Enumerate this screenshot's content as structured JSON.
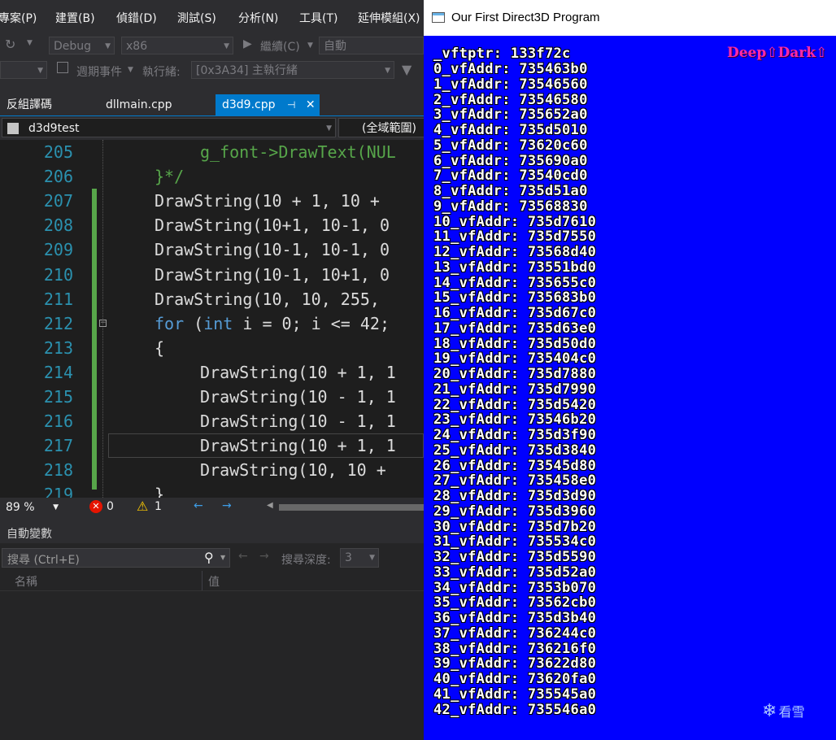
{
  "vs": {
    "menu": [
      "專案(P)",
      "建置(B)",
      "偵錯(D)",
      "測試(S)",
      "分析(N)",
      "工具(T)",
      "延伸模組(X)"
    ],
    "toolbar": {
      "config": "Debug",
      "platform": "x86",
      "continue": "繼續(C)",
      "auto": "自動"
    },
    "toolbar2": {
      "events": "週期事件",
      "thread_label": "執行緒:",
      "thread_value": "[0x3A34] 主執行緒"
    },
    "tabs": [
      {
        "label": "反組譯碼"
      },
      {
        "label": "dllmain.cpp"
      },
      {
        "label": "d3d9.cpp",
        "pin": "⊣",
        "close": "✕"
      }
    ],
    "nav": {
      "project": "d3d9test",
      "scope": "(全域範圍)"
    },
    "editor": {
      "lines": [
        {
          "num": "205",
          "indent": 2,
          "segments": [
            {
              "t": "g_font->DrawText(NUL",
              "c": "cm"
            }
          ]
        },
        {
          "num": "206",
          "indent": 0,
          "segments": [
            {
              "t": "}*/",
              "c": "cm"
            }
          ]
        },
        {
          "num": "207",
          "indent": 0,
          "segments": [
            {
              "t": "DrawString(10 + 1, 10 +",
              "c": ""
            }
          ]
        },
        {
          "num": "208",
          "indent": 0,
          "segments": [
            {
              "t": "DrawString(10+1, 10-1, 0",
              "c": ""
            }
          ]
        },
        {
          "num": "209",
          "indent": 0,
          "segments": [
            {
              "t": "DrawString(10-1, 10-1, 0",
              "c": ""
            }
          ]
        },
        {
          "num": "210",
          "indent": 0,
          "segments": [
            {
              "t": "DrawString(10-1, 10+1, 0",
              "c": ""
            }
          ]
        },
        {
          "num": "211",
          "indent": 0,
          "segments": [
            {
              "t": "DrawString(10, 10, 255,",
              "c": ""
            }
          ]
        },
        {
          "num": "212",
          "indent": 0,
          "segments": [
            {
              "t": "for",
              "c": "kw"
            },
            {
              "t": " (",
              "c": ""
            },
            {
              "t": "int",
              "c": "kw"
            },
            {
              "t": " i = 0; i <= 42;",
              "c": ""
            }
          ]
        },
        {
          "num": "213",
          "indent": 0,
          "segments": [
            {
              "t": "{",
              "c": ""
            }
          ]
        },
        {
          "num": "214",
          "indent": 2,
          "segments": [
            {
              "t": "DrawString(10 + 1, 1",
              "c": ""
            }
          ]
        },
        {
          "num": "215",
          "indent": 2,
          "segments": [
            {
              "t": "DrawString(10 - 1, 1",
              "c": ""
            }
          ]
        },
        {
          "num": "216",
          "indent": 2,
          "segments": [
            {
              "t": "DrawString(10 - 1, 1",
              "c": ""
            }
          ]
        },
        {
          "num": "217",
          "indent": 2,
          "segments": [
            {
              "t": "DrawString(10 + 1, 1",
              "c": ""
            }
          ]
        },
        {
          "num": "218",
          "indent": 2,
          "segments": [
            {
              "t": "DrawString(10, 10 +",
              "c": ""
            }
          ]
        },
        {
          "num": "219",
          "indent": 0,
          "segments": [
            {
              "t": "}",
              "c": ""
            }
          ]
        }
      ]
    },
    "status": {
      "zoom": "89 %",
      "errors": "0",
      "warnings": "1"
    },
    "autos": {
      "title": "自動變數",
      "search_placeholder": "搜尋 (Ctrl+E)",
      "depth_label": "搜尋深度:",
      "depth_value": "3",
      "col_name": "名稱",
      "col_value": "值"
    }
  },
  "d3d": {
    "title": "Our First Direct3D Program",
    "vftptr": "_vftptr: 133f72c",
    "watermark": "Deep⇧Dark⇧",
    "corner_logo": "看雪",
    "vfaddrs": [
      "0_vfAddr: 735463b0",
      "1_vfAddr: 73546560",
      "2_vfAddr: 73546580",
      "3_vfAddr: 735652a0",
      "4_vfAddr: 735d5010",
      "5_vfAddr: 73620c60",
      "6_vfAddr: 735690a0",
      "7_vfAddr: 73540cd0",
      "8_vfAddr: 735d51a0",
      "9_vfAddr: 73568830",
      "10_vfAddr: 735d7610",
      "11_vfAddr: 735d7550",
      "12_vfAddr: 73568d40",
      "13_vfAddr: 73551bd0",
      "14_vfAddr: 735655c0",
      "15_vfAddr: 735683b0",
      "16_vfAddr: 735d67c0",
      "17_vfAddr: 735d63e0",
      "18_vfAddr: 735d50d0",
      "19_vfAddr: 735404c0",
      "20_vfAddr: 735d7880",
      "21_vfAddr: 735d7990",
      "22_vfAddr: 735d5420",
      "23_vfAddr: 73546b20",
      "24_vfAddr: 735d3f90",
      "25_vfAddr: 735d3840",
      "26_vfAddr: 73545d80",
      "27_vfAddr: 735458e0",
      "28_vfAddr: 735d3d90",
      "29_vfAddr: 735d3960",
      "30_vfAddr: 735d7b20",
      "31_vfAddr: 735534c0",
      "32_vfAddr: 735d5590",
      "33_vfAddr: 735d52a0",
      "34_vfAddr: 7353b070",
      "35_vfAddr: 73562cb0",
      "36_vfAddr: 735d3b40",
      "37_vfAddr: 736244c0",
      "38_vfAddr: 736216f0",
      "39_vfAddr: 73622d80",
      "40_vfAddr: 73620fa0",
      "41_vfAddr: 735545a0",
      "42_vfAddr: 735546a0"
    ]
  },
  "colors": {
    "vs_bg": "#2d2d30",
    "editor_bg": "#1e1e1e",
    "accent": "#007acc",
    "d3d_bg": "#0000ff",
    "keyword": "#569cd6",
    "comment": "#57a64a",
    "line_number": "#2b91af"
  }
}
